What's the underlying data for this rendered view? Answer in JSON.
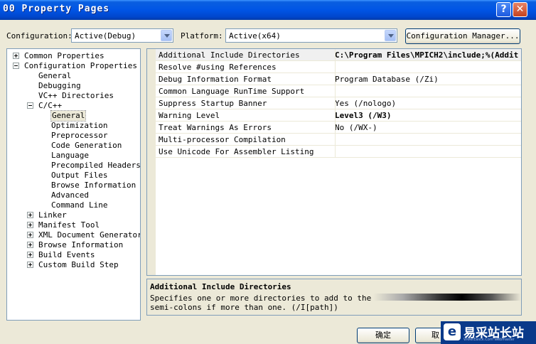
{
  "window": {
    "title": "00 Property Pages",
    "help_glyph": "?",
    "close_glyph": "✕"
  },
  "top": {
    "configuration_label": "Configuration:",
    "configuration_value": "Active(Debug)",
    "platform_label": "Platform:",
    "platform_value": "Active(x64)",
    "config_manager_label": "Configuration Manager..."
  },
  "tree": [
    {
      "label": "Common Properties",
      "level": 0,
      "expander": "plus"
    },
    {
      "label": "Configuration Properties",
      "level": 0,
      "expander": "minus"
    },
    {
      "label": "General",
      "level": 1,
      "expander": ""
    },
    {
      "label": "Debugging",
      "level": 1,
      "expander": ""
    },
    {
      "label": "VC++ Directories",
      "level": 1,
      "expander": ""
    },
    {
      "label": "C/C++",
      "level": 1,
      "expander": "minus"
    },
    {
      "label": "General",
      "level": 2,
      "expander": "",
      "selected": true
    },
    {
      "label": "Optimization",
      "level": 2,
      "expander": ""
    },
    {
      "label": "Preprocessor",
      "level": 2,
      "expander": ""
    },
    {
      "label": "Code Generation",
      "level": 2,
      "expander": ""
    },
    {
      "label": "Language",
      "level": 2,
      "expander": ""
    },
    {
      "label": "Precompiled Headers",
      "level": 2,
      "expander": ""
    },
    {
      "label": "Output Files",
      "level": 2,
      "expander": ""
    },
    {
      "label": "Browse Information",
      "level": 2,
      "expander": ""
    },
    {
      "label": "Advanced",
      "level": 2,
      "expander": ""
    },
    {
      "label": "Command Line",
      "level": 2,
      "expander": ""
    },
    {
      "label": "Linker",
      "level": 1,
      "expander": "plus"
    },
    {
      "label": "Manifest Tool",
      "level": 1,
      "expander": "plus"
    },
    {
      "label": "XML Document Generator",
      "level": 1,
      "expander": "plus"
    },
    {
      "label": "Browse Information",
      "level": 1,
      "expander": "plus"
    },
    {
      "label": "Build Events",
      "level": 1,
      "expander": "plus"
    },
    {
      "label": "Custom Build Step",
      "level": 1,
      "expander": "plus"
    }
  ],
  "properties": [
    {
      "name": "Additional Include Directories",
      "value": "C:\\Program Files\\MPICH2\\include;%(Addit",
      "bold": true
    },
    {
      "name": "Resolve #using References",
      "value": "",
      "bold": false
    },
    {
      "name": "Debug Information Format",
      "value": "Program Database (/Zi)",
      "bold": false
    },
    {
      "name": "Common Language RunTime Support",
      "value": "",
      "bold": false
    },
    {
      "name": "Suppress Startup Banner",
      "value": "Yes (/nologo)",
      "bold": false
    },
    {
      "name": "Warning Level",
      "value": "Level3 (/W3)",
      "bold": true
    },
    {
      "name": "Treat Warnings As Errors",
      "value": "No (/WX-)",
      "bold": false
    },
    {
      "name": "Multi-processor Compilation",
      "value": "",
      "bold": false
    },
    {
      "name": "Use Unicode For Assembler Listing",
      "value": "",
      "bold": false
    }
  ],
  "description": {
    "title": "Additional Include Directories",
    "line1": "Specifies one or more directories to add to the incl",
    "line2": "semi-colons if more than one.     (/I[path])"
  },
  "buttons": {
    "ok_label": "确定",
    "cancel_label": "取"
  },
  "watermark": {
    "logo_glyph": "e",
    "text": "易采站长站",
    "sub": "Www.Easck.Com Webmaster"
  }
}
